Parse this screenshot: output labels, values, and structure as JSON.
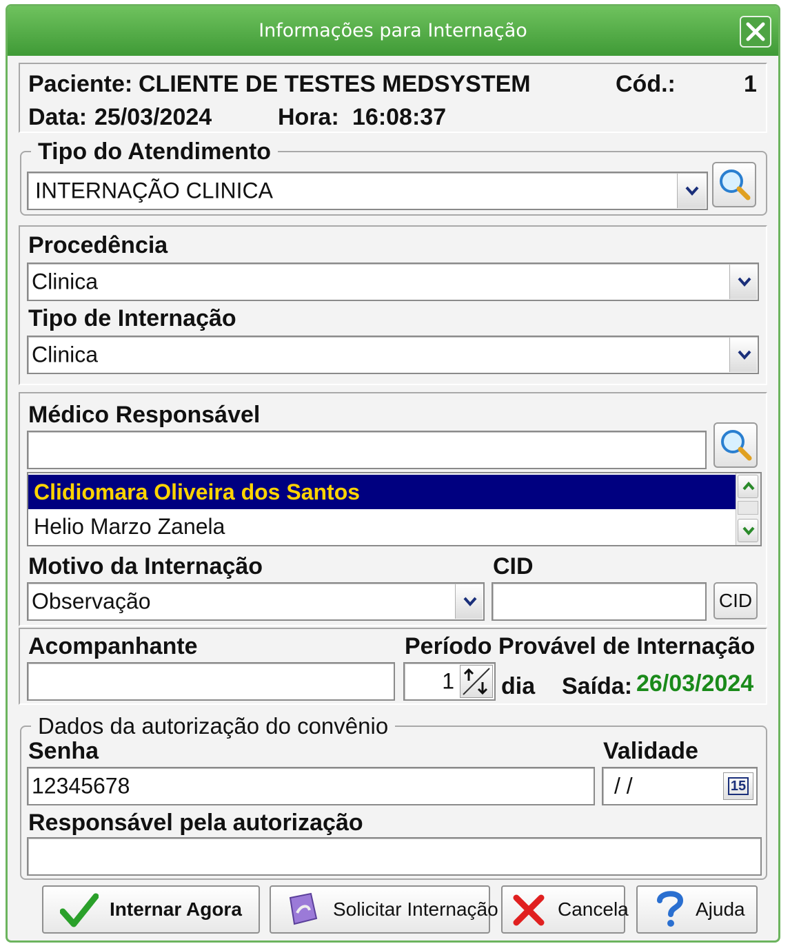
{
  "window": {
    "title": "Informações para Internação"
  },
  "patient": {
    "label": "Paciente:",
    "name": "CLIENTE DE TESTES MEDSYSTEM",
    "code_label": "Cód.:",
    "code": "1",
    "date_label": "Data:",
    "date": "25/03/2024",
    "time_label": "Hora:",
    "time": "16:08:37"
  },
  "tipo_atendimento": {
    "legend": "Tipo do Atendimento",
    "value": "INTERNAÇÃO CLINICA"
  },
  "procedencia": {
    "label": "Procedência",
    "value": "Clinica"
  },
  "tipo_internacao": {
    "label": "Tipo de Internação",
    "value": "Clinica"
  },
  "medico": {
    "label": "Médico Responsável",
    "search_value": "",
    "list": [
      "Clidiomara Oliveira dos Santos",
      "Helio Marzo Zanela"
    ],
    "selected_index": 0
  },
  "motivo": {
    "label": "Motivo da Internação",
    "value": "Observação"
  },
  "cid": {
    "label": "CID",
    "value": "",
    "button_label": "CID"
  },
  "acompanhante": {
    "label": "Acompanhante",
    "value": ""
  },
  "periodo": {
    "label": "Período Provável de Internação",
    "days": "1",
    "unit": "dia",
    "saida_label": "Saída:",
    "saida": "26/03/2024",
    "saida_color": "#1a8a1a"
  },
  "autorizacao": {
    "legend": "Dados da autorização do convênio",
    "senha_label": "Senha",
    "senha": "12345678",
    "validade_label": "Validade",
    "validade": "/ /",
    "calendar_label": "15",
    "responsavel_label": "Responsável pela autorização",
    "responsavel": ""
  },
  "buttons": {
    "internar": "Internar Agora",
    "solicitar": "Solicitar Internação",
    "cancela": "Cancela",
    "ajuda": "Ajuda"
  },
  "colors": {
    "title_bar": "#4ea443",
    "selection_bg": "#000080",
    "selection_fg": "#ffd400"
  }
}
